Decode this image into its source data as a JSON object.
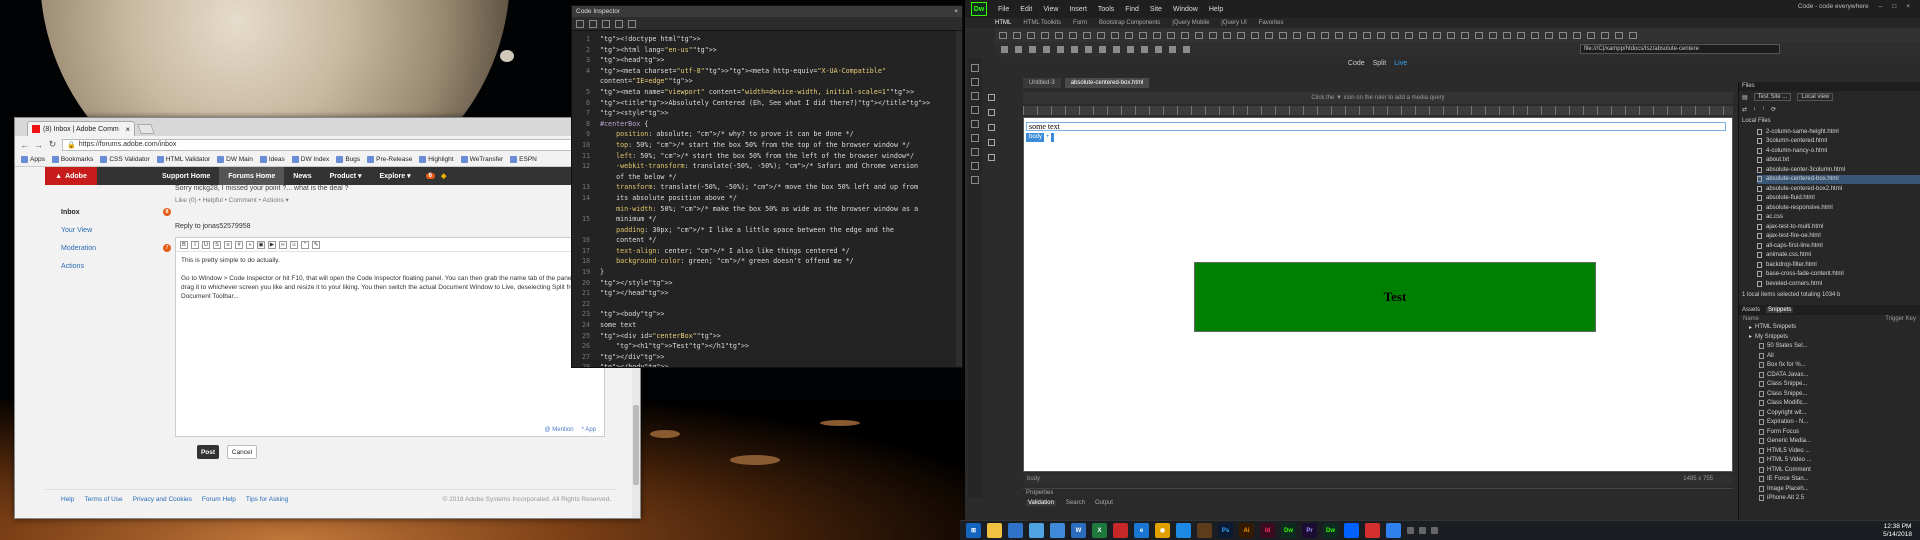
{
  "browser": {
    "tab_title": "(8) Inbox | Adobe Comm",
    "url": "https://forums.adobe.com/inbox",
    "bookmarks": [
      "Apps",
      "Bookmarks",
      "CSS Validator",
      "HTML Validator",
      "DW Main",
      "Ideas",
      "DW Index",
      "Bugs",
      "Pre-Release",
      "Highlight",
      "WeTransfer",
      "ESPN"
    ]
  },
  "adobe_nav": {
    "logo": "Adobe",
    "items": [
      "Support Home",
      "Forums Home",
      "News",
      "Product ▾",
      "Explore ▾"
    ],
    "badge": "6"
  },
  "sidebar": {
    "items": [
      {
        "label": "Inbox",
        "count": "8"
      },
      {
        "label": "Your View",
        "count": ""
      },
      {
        "label": "Moderation",
        "count": "7"
      },
      {
        "label": "Actions",
        "count": ""
      }
    ]
  },
  "thread": {
    "prev_line": "Sorry nickg28, I missed your point ?... what is the deal ?",
    "prev_actions": "Like (0) • Helpful • Comment • Actions ▾",
    "reply_to": "Reply to jonas52579958",
    "editor_p1": "This is pretty simple to do actually.",
    "editor_p2": "Go to Window > Code Inspector or hit F10, that will open the Code Inspector floating panel. You can then grab the name tab of the panel and drag it to whichever screen you like and resize it to your liking. You then switch the actual Document Window to Live, deselecting Split from the Document Toolbar...",
    "mention": "@ Mention",
    "app": "* App",
    "post_label": "Post",
    "cancel_label": "Cancel"
  },
  "footer": {
    "links": [
      "Help",
      "Terms of Use",
      "Privacy and Cookies",
      "Forum Help",
      "Tips for Asking"
    ],
    "copyright": "© 2018 Adobe Systems Incorporated. All Rights Reserved."
  },
  "code_inspector": {
    "title": "Code Inspector",
    "line_numbers": [
      "1",
      "2",
      "3",
      "4",
      "5",
      "6",
      "7",
      "8",
      "9",
      "10",
      "11",
      "12",
      "",
      "13",
      "14",
      "",
      "15",
      "",
      "16",
      "17",
      "18",
      "19",
      "20",
      "21",
      "22",
      "23",
      "24",
      "25",
      "26",
      "27",
      "28"
    ],
    "lines": [
      "<!doctype html>",
      "<html lang=\"en-us\">",
      "<head>",
      "<meta charset=\"utf-8\"><meta http-equiv=\"X-UA-Compatible\" content=\"IE=edge\">",
      "<meta name=\"viewport\" content=\"width=device-width, initial-scale=1\">",
      "<title>Absolutely Centered (Eh, See what I did there?)</title>",
      "<style>",
      "#centerBox {",
      "    position: absolute; /* why? to prove it can be done */",
      "    top: 50%; /* start the box 50% from the top of the browser window */",
      "    left: 50%; /* start the box 50% from the left of the browser window*/",
      "    -webkit-transform: translate(-50%, -50%); /* Safari and Chrome version",
      "    of the below */",
      "    transform: translate(-50%, -50%); /* move the box 50% left and up from",
      "    its absolute position above */",
      "    min-width: 50%; /* make the box 50% as wide as the browser window as a",
      "    minimum */",
      "    padding: 30px; /* I like a little space between the edge and the",
      "    content */",
      "    text-align: center; /* I also like things centered */",
      "    background-color: green; /* green doesn't offend me */",
      "}",
      "</style>",
      "</head>",
      "",
      "<body>",
      "some text",
      "<div id=\"centerBox\">",
      "    <h1>Test</h1>",
      "</div>",
      "</body>",
      "</html>"
    ]
  },
  "dreamweaver": {
    "logo": "Dw",
    "menus": [
      "File",
      "Edit",
      "View",
      "Insert",
      "Tools",
      "Find",
      "Site",
      "Window",
      "Help"
    ],
    "workspace": "Code - code everywhere",
    "insert_tabs": [
      "HTML",
      "HTML Toolkits",
      "Form",
      "Bootstrap Components",
      "jQuery Mobile",
      "jQuery UI",
      "Favorites"
    ],
    "url": "file:///C|/xampp/htdocs/tsz/absolute-centere",
    "views": [
      "Code",
      "Split",
      "Live"
    ],
    "doc_tabs": [
      "Untitled-3",
      "absolute-centered-box.html"
    ],
    "media_query_hint": "Click the ▼ icon on the ruler to add a media query",
    "live_text": "some text",
    "body_tag": "body",
    "box_heading": "Test",
    "status_tag": "body",
    "dimensions": "1485 x 755",
    "properties_title": "Properties",
    "bottom_tabs": [
      "Validation",
      "Search",
      "Output"
    ]
  },
  "files_panel": {
    "title": "Files",
    "site": "Test Site ...",
    "view": "Local view",
    "local_label": "Local Files",
    "files": [
      "2-column-same-height.html",
      "3column-centered.html",
      "4-column-nancy-o.html",
      "about.txt",
      "absolute-center-3column.html",
      "absolute-centered-box.html",
      "absolute-centered-box2.html",
      "absolute-fluid.html",
      "absolute-responsive.html",
      "ac.css",
      "ajax-test-to-multi.html",
      "ajax-test-fire-oe.html",
      "all-caps-first-line.html",
      "animate.css.html",
      "backdrop-filter.html",
      "base-cross-fade-content.html",
      "beveled-corners.html"
    ],
    "selected_index": 5,
    "footer_note": "1 local items selected totaling 1034 b"
  },
  "snippets_panel": {
    "tabs": [
      "Assets",
      "Snippets"
    ],
    "col_name": "Name",
    "col_key": "Trigger Key",
    "items": [
      {
        "label": "HTML Snippets",
        "level": 1
      },
      {
        "label": "My Snippets",
        "level": 1
      },
      {
        "label": "50 States Sel...",
        "level": 2
      },
      {
        "label": "All",
        "level": 2
      },
      {
        "label": "Box fix for %...",
        "level": 2
      },
      {
        "label": "CDATA Javas...",
        "level": 2
      },
      {
        "label": "Class Snippe...",
        "level": 2
      },
      {
        "label": "Class Snippe...",
        "level": 2
      },
      {
        "label": "Class Modific...",
        "level": 2
      },
      {
        "label": "Copyright wit...",
        "level": 2
      },
      {
        "label": "Expiration - N...",
        "level": 2
      },
      {
        "label": "Form Focus",
        "level": 2
      },
      {
        "label": "Generic Media...",
        "level": 2
      },
      {
        "label": "HTML5 Video ...",
        "level": 2
      },
      {
        "label": "HTML 5 Video ...",
        "level": 2
      },
      {
        "label": "HTML Comment",
        "level": 2
      },
      {
        "label": "IE Force Stan...",
        "level": 2
      },
      {
        "label": "Image Placeh...",
        "level": 2
      },
      {
        "label": "iPhone Alt 2.5",
        "level": 2
      }
    ]
  },
  "taskbar": {
    "time": "12:38 PM",
    "date": "5/14/2018",
    "apps": [
      "Ps",
      "Ai",
      "Id",
      "Dw",
      "Pr",
      "Dw"
    ]
  }
}
